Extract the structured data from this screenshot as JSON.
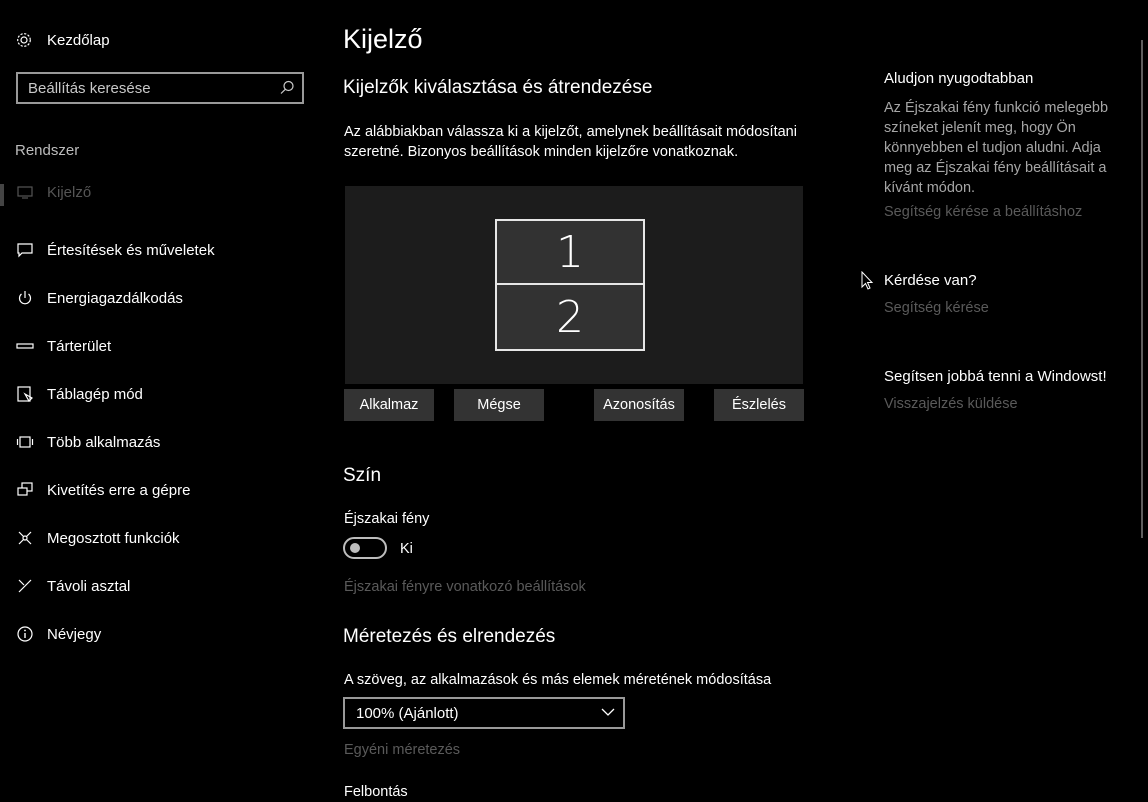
{
  "sidebar": {
    "home_label": "Kezdőlap",
    "search_placeholder": "Beállítás keresése",
    "section": "Rendszer",
    "items": [
      {
        "label": "Kijelző",
        "icon": "monitor-icon",
        "active": true
      },
      {
        "label": "Értesítések és műveletek",
        "icon": "notification-icon"
      },
      {
        "label": "Energiagazdálkodás",
        "icon": "power-icon"
      },
      {
        "label": "Tárterület",
        "icon": "storage-icon"
      },
      {
        "label": "Táblagép mód",
        "icon": "tablet-mode-icon"
      },
      {
        "label": "Több alkalmazás",
        "icon": "multitasking-icon"
      },
      {
        "label": "Kivetítés erre a gépre",
        "icon": "projecting-icon"
      },
      {
        "label": "Megosztott funkciók",
        "icon": "shared-experiences-icon"
      },
      {
        "label": "Távoli asztal",
        "icon": "remote-desktop-icon"
      },
      {
        "label": "Névjegy",
        "icon": "info-icon"
      }
    ]
  },
  "main": {
    "title": "Kijelző",
    "arrange_heading": "Kijelzők kiválasztása és átrendezése",
    "arrange_desc": "Az alábbiakban válassza ki a kijelzőt, amelynek beállításait módosítani szeretné. Bizonyos beállítások minden kijelzőre vonatkoznak.",
    "monitors": [
      "1",
      "2"
    ],
    "buttons": {
      "apply": "Alkalmaz",
      "cancel": "Mégse",
      "identify": "Azonosítás",
      "detect": "Észlelés"
    },
    "color_heading": "Szín",
    "night_light_label": "Éjszakai fény",
    "night_light_state": "Ki",
    "night_light_settings_link": "Éjszakai fényre vonatkozó beállítások",
    "scale_heading": "Méretezés és elrendezés",
    "scale_label": "A szöveg, az alkalmazások és más elemek méretének módosítása",
    "scale_value": "100% (Ajánlott)",
    "custom_scaling_link": "Egyéni méretezés",
    "resolution_label": "Felbontás"
  },
  "right": {
    "sleep_heading": "Aludjon nyugodtabban",
    "sleep_text": "Az Éjszakai fény funkció melegebb színeket jelenít meg, hogy Ön könnyebben el tudjon aludni. Adja meg az Éjszakai fény beállításait a kívánt módon.",
    "sleep_link": "Segítség kérése a beállításhoz",
    "question_heading": "Kérdése van?",
    "question_link": "Segítség kérése",
    "feedback_heading": "Segítsen jobbá tenni a Windowst!",
    "feedback_link": "Visszajelzés küldése"
  }
}
